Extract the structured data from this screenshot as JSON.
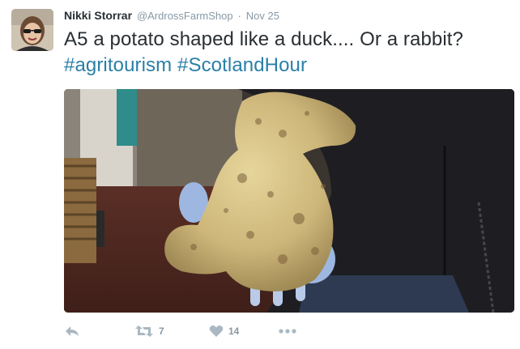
{
  "tweet": {
    "author_name": "Nikki Storrar",
    "author_handle": "@ArdrossFarmShop",
    "separator": "·",
    "timestamp": "Nov 25",
    "text_plain": "A5 a potato shaped like a duck.... Or a rabbit? ",
    "hashtags": [
      "#agritourism",
      "#ScotlandHour"
    ],
    "retweet_count": "7",
    "like_count": "14"
  },
  "icons": {
    "reply": "reply-icon",
    "retweet": "retweet-icon",
    "like": "heart-icon",
    "more": "more-dots-icon"
  },
  "colors": {
    "hashtag": "#2a7fa8",
    "secondary_text": "#8899a6",
    "icon_gray": "#aab8c2",
    "name_text": "#292f33"
  }
}
